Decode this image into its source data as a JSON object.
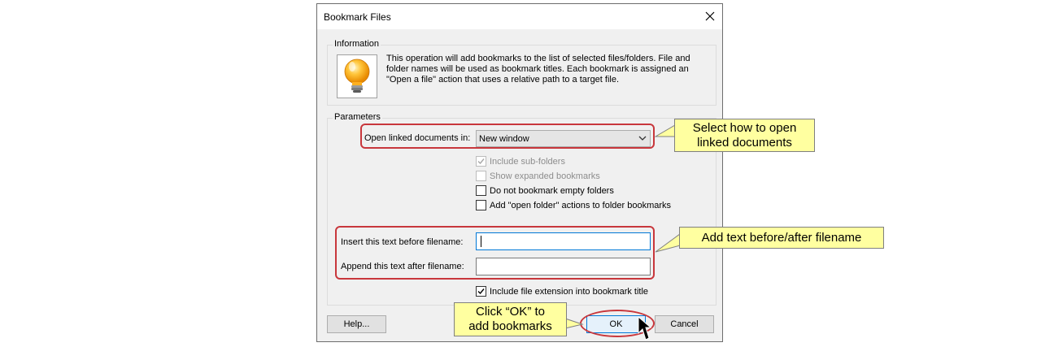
{
  "window": {
    "title": "Bookmark Files"
  },
  "information": {
    "group_label": "Information",
    "text": "This operation will add bookmarks to the list of selected files/folders. File and folder names will be used as bookmark titles. Each bookmark is assigned an \"Open a file\" action that uses a relative path to a target file."
  },
  "parameters": {
    "group_label": "Parameters",
    "open_label": "Open linked documents in:",
    "open_value": "New window",
    "checkboxes": [
      {
        "label": "Include sub-folders",
        "checked": true,
        "disabled": true
      },
      {
        "label": "Show expanded bookmarks",
        "checked": false,
        "disabled": true
      },
      {
        "label": "Do not bookmark empty folders",
        "checked": false,
        "disabled": false
      },
      {
        "label": "Add \"open folder\" actions to folder bookmarks",
        "checked": false,
        "disabled": false
      }
    ],
    "insert_label": "Insert this text before filename:",
    "insert_value": "",
    "append_label": "Append this text after filename:",
    "append_value": "",
    "ext_label": "Include file extension into bookmark title",
    "ext_checked": true
  },
  "buttons": {
    "help": "Help...",
    "ok": "OK",
    "cancel": "Cancel"
  },
  "callouts": {
    "open": [
      "Select how to open",
      "linked documents"
    ],
    "text": "Add text before/after filename",
    "ok": [
      "Click “OK” to",
      "add bookmarks"
    ]
  },
  "colors": {
    "highlight": "#c8373c",
    "callout_bg": "#ffffa0",
    "accent": "#0078d7"
  }
}
